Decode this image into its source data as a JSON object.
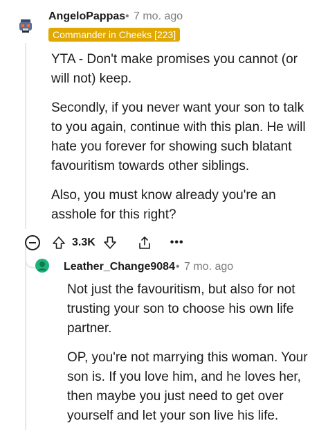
{
  "comment": {
    "username": "AngeloPappas",
    "separator": "•",
    "age": "7 mo. ago",
    "flair": "Commander in Cheeks [223]",
    "paragraphs": [
      "YTA - Don't make promises you cannot (or will not) keep.",
      "Secondly, if you never want your son to talk to you again, continue with this plan. He will hate you forever for showing such blatant favouritism towards other siblings.",
      "Also, you must know already you're an asshole for this right?"
    ],
    "vote_count": "3.3K",
    "more_label": "•••"
  },
  "reply": {
    "username": "Leather_Change9084",
    "separator": "•",
    "age": "7 mo. ago",
    "paragraphs": [
      "Not just the favouritism, but also for not trusting your son to choose his own life partner.",
      "OP, you're not marrying this woman. Your son is. If you love him, and he loves her, then maybe you just need to get over yourself and let your son live his life."
    ]
  },
  "colors": {
    "flair_bg": "#e0a800",
    "meta_text": "#7c7c7c",
    "thread_line": "#e5e7ea",
    "reply_avatar": "#1fb37a"
  }
}
